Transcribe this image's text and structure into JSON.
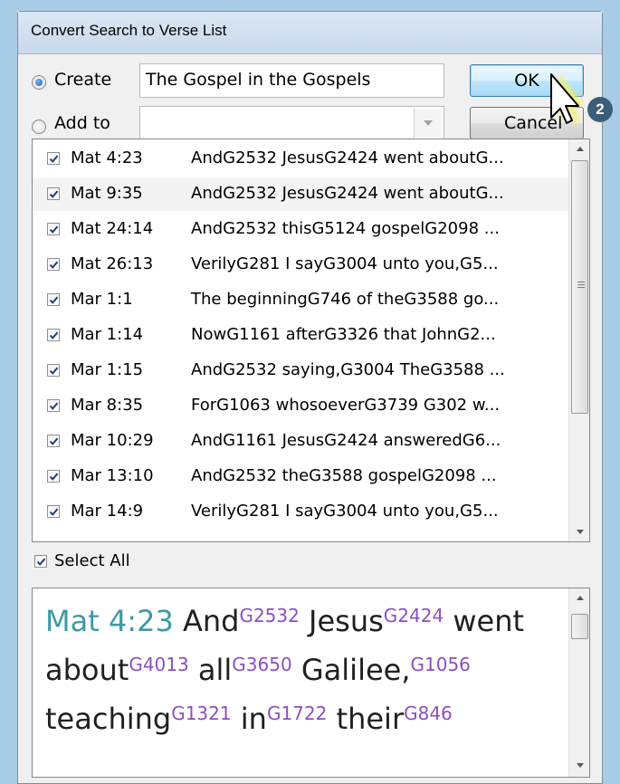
{
  "window": {
    "title": "Convert Search to Verse List"
  },
  "create": {
    "label": "Create",
    "value": "The Gospel in the Gospels",
    "selected": true
  },
  "add_to": {
    "label": "Add to",
    "value": "",
    "selected": false
  },
  "buttons": {
    "ok": "OK",
    "cancel": "Cancel"
  },
  "verse_list": [
    {
      "ref": "Mat 4:23",
      "text": "AndG2532 JesusG2424 went aboutG...",
      "checked": true
    },
    {
      "ref": "Mat 9:35",
      "text": "AndG2532 JesusG2424 went aboutG...",
      "checked": true
    },
    {
      "ref": "Mat 24:14",
      "text": "AndG2532 thisG5124 gospelG2098 ...",
      "checked": true
    },
    {
      "ref": "Mat 26:13",
      "text": "VerilyG281 I sayG3004 unto you,G5...",
      "checked": true
    },
    {
      "ref": "Mar 1:1",
      "text": "The beginningG746 of theG3588 go...",
      "checked": true
    },
    {
      "ref": "Mar 1:14",
      "text": "NowG1161 afterG3326 that JohnG2...",
      "checked": true
    },
    {
      "ref": "Mar 1:15",
      "text": "AndG2532 saying,G3004 TheG3588 ...",
      "checked": true
    },
    {
      "ref": "Mar 8:35",
      "text": "ForG1063 whosoeverG3739 G302 w...",
      "checked": true
    },
    {
      "ref": "Mar 10:29",
      "text": "AndG1161 JesusG2424 answeredG6...",
      "checked": true
    },
    {
      "ref": "Mar 13:10",
      "text": "AndG2532 theG3588 gospelG2098 ...",
      "checked": true
    },
    {
      "ref": "Mar 14:9",
      "text": "VerilyG281 I sayG3004 unto you,G5...",
      "checked": true
    }
  ],
  "select_all": {
    "label": "Select All",
    "checked": true
  },
  "preview": {
    "ref": "Mat 4:23",
    "words": [
      {
        "w": "And",
        "s": "G2532"
      },
      {
        "w": "Jesus",
        "s": "G2424"
      },
      {
        "w": "went about",
        "s": "G4013"
      },
      {
        "w": "all",
        "s": "G3650"
      },
      {
        "w": "Galilee,",
        "s": "G1056"
      },
      {
        "w": "teaching",
        "s": "G1321"
      },
      {
        "w": "in",
        "s": "G1722"
      },
      {
        "w": "their",
        "s": "G846"
      }
    ]
  },
  "step_badge": "2",
  "colors": {
    "ref_color": "#3c9aa5",
    "strongs_color": "#8b4fc1",
    "backdrop": "#a9cce6"
  }
}
